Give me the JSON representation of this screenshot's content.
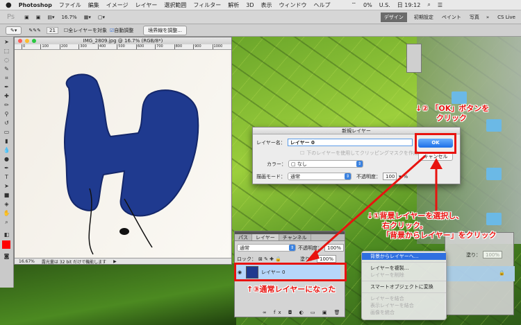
{
  "menubar": {
    "app": "Photoshop",
    "items": [
      "ファイル",
      "編集",
      "イメージ",
      "レイヤー",
      "選択範囲",
      "フィルター",
      "解析",
      "3D",
      "表示",
      "ウィンドウ",
      "ヘルプ"
    ],
    "battery": "0%",
    "input": "U.S.",
    "clock": "日 19:12"
  },
  "appbar": {
    "zoom": "16.7%",
    "workspaces": [
      "デザイン",
      "初期設定",
      "ペイント",
      "写真"
    ],
    "more": "»",
    "cslive": "CS Live"
  },
  "optbar": {
    "brush_size": "21",
    "all_layers": "全レイヤーを対象",
    "auto_enhance": "自動調整",
    "refine": "境界線を調整..."
  },
  "document": {
    "title": "IMG_2809.jpg @ 16.7% (RGB/8*)",
    "ruler": [
      "0",
      "100",
      "200",
      "300",
      "400",
      "500",
      "600",
      "700",
      "800",
      "900",
      "1000"
    ],
    "zoom": "16.67%",
    "status": "露光量は 32 bit だけで機能します"
  },
  "dialog": {
    "title": "新規レイヤー",
    "name_label": "レイヤー名：",
    "name_value": "レイヤー 0",
    "clip_label": "下のレイヤーを使用してクリッピングマスクを作成",
    "color_label": "カラー：",
    "color_value": "なし",
    "mode_label": "描画モード：",
    "mode_value": "通常",
    "opacity_label": "不透明度：",
    "opacity_value": "100",
    "percent": "%",
    "ok": "OK",
    "cancel": "キャンセル"
  },
  "layers": {
    "tabs": [
      "パス",
      "レイヤー",
      "チャンネル"
    ],
    "blend": "通常",
    "opacity_label": "不透明度：",
    "opacity": "100%",
    "lock_label": "ロック：",
    "fill_label": "塗り：",
    "fill": "100%",
    "layer_name": "レイヤー 0"
  },
  "context_menu": {
    "items": [
      {
        "label": "背景からレイヤーへ...",
        "state": "highlighted"
      },
      {
        "label": "レイヤーを複製...",
        "state": "enabled"
      },
      {
        "label": "レイヤーを削除",
        "state": "disabled"
      },
      {
        "label": "スマートオブジェクトに変換",
        "state": "enabled"
      },
      {
        "label": "レイヤーを結合",
        "state": "disabled"
      },
      {
        "label": "表示レイヤーを結合",
        "state": "disabled"
      },
      {
        "label": "画像を統合",
        "state": "disabled"
      }
    ]
  },
  "right_panel": {
    "fill_label": "塗り：",
    "fill": "100%"
  },
  "annotations": {
    "step2_line1": "↓② 「OK」ボタンを",
    "step2_line2": "クリック",
    "step1_line1": "↓①背景レイヤーを選択し、",
    "step1_line2": "右クリック。",
    "step1_line3": "「背景からレイヤー」をクリック",
    "step3": "↑③通常レイヤーになった"
  },
  "colors": {
    "annotation": "#e8130f",
    "accent": "#2f6fe0",
    "foreground": "#ff0000"
  }
}
